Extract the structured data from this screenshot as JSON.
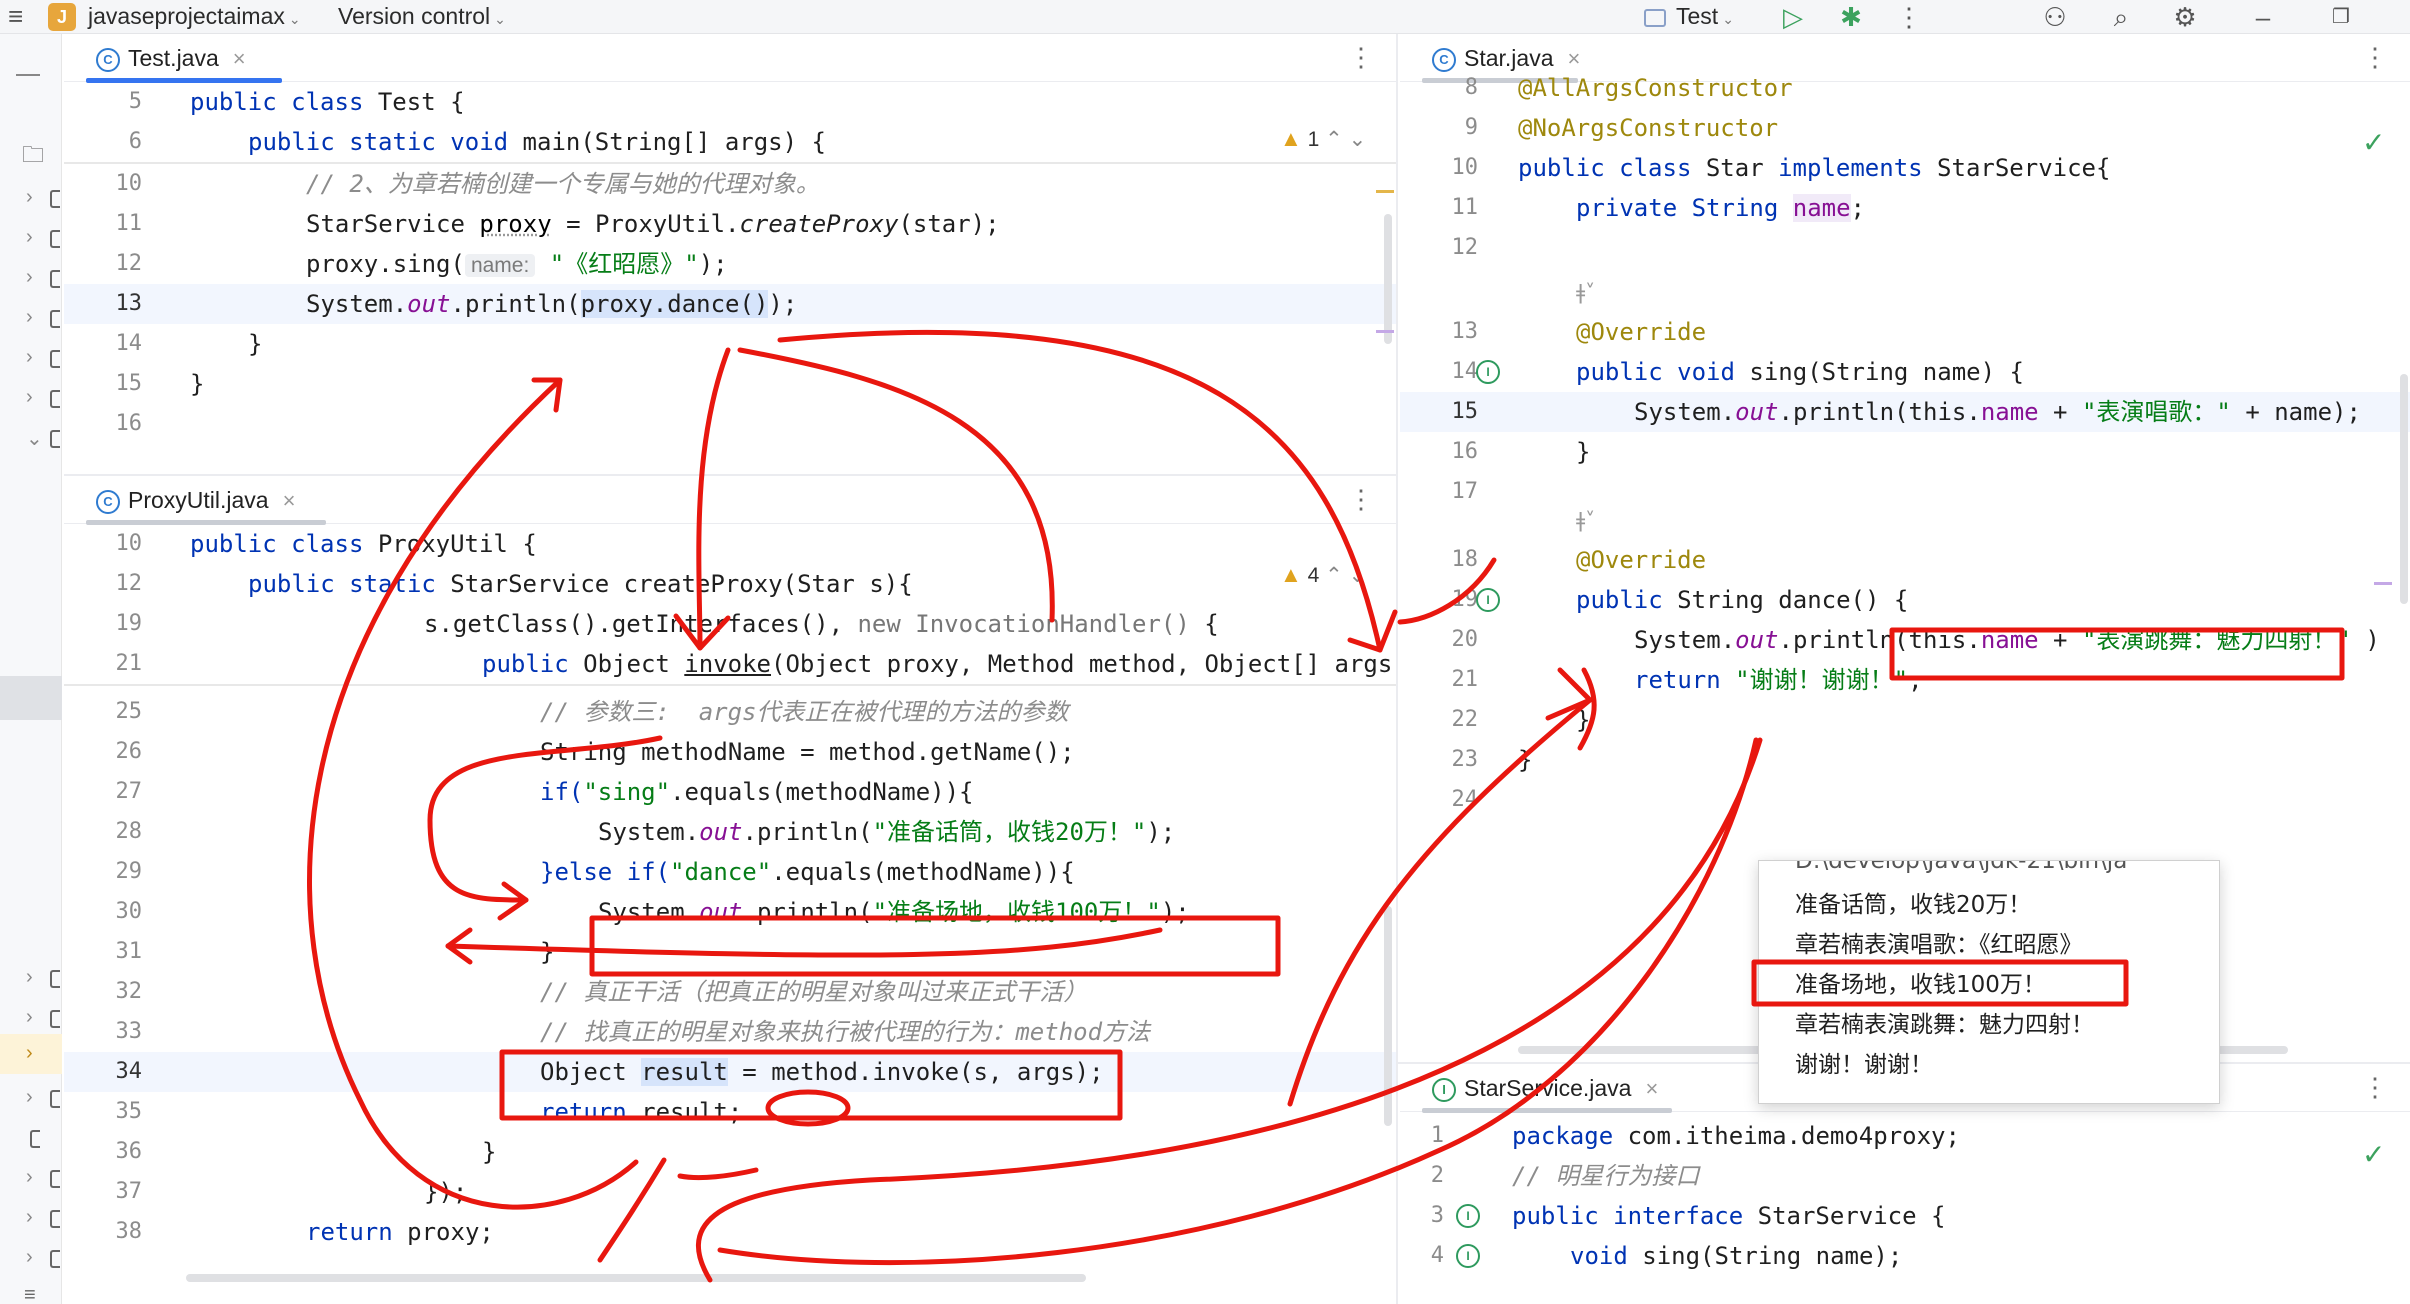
{
  "titlebar": {
    "project_letter": "J",
    "project_name": "javaseprojectaimax",
    "vcs_label": "Version control",
    "run_config": "Test"
  },
  "editors": {
    "test": {
      "tab": "Test.java",
      "warnings": "1",
      "lines": [
        {
          "n": "5",
          "t": "public class Test {"
        },
        {
          "n": "6",
          "t": "public static void main(String[] args) {"
        },
        {
          "n": "10",
          "t": "// 2、为章若楠创建一个专属与她的代理对象。"
        },
        {
          "n": "11",
          "t_pre": "StarService ",
          "var": "proxy",
          "t_mid": " = ProxyUtil.",
          "call": "createProxy",
          "t_post": "(star);"
        },
        {
          "n": "12",
          "t_pre": "proxy.sing(",
          "hint": "name:",
          "str": "\"《红昭愿》\"",
          "t_post": ");"
        },
        {
          "n": "13",
          "t_pre": "System.",
          "out": "out",
          "t_mid": ".println(",
          "hl": "proxy.dance()",
          "t_post": ");"
        },
        {
          "n": "14",
          "t": "}"
        },
        {
          "n": "15",
          "t": "}"
        },
        {
          "n": "16",
          "t": ""
        }
      ]
    },
    "proxyutil": {
      "tab": "ProxyUtil.java",
      "warnings": "4",
      "lines": [
        {
          "n": "10",
          "t": "public class ProxyUtil {"
        },
        {
          "n": "12",
          "t": "public static StarService createProxy(Star s){"
        },
        {
          "n": "19",
          "t": "s.getClass().getInterfaces(), new InvocationHandler() {"
        },
        {
          "n": "21",
          "t": "public Object invoke(Object proxy, Method method, Object[] args"
        },
        {
          "n": "25",
          "t": "// 参数三:  args代表正在被代理的方法的参数"
        },
        {
          "n": "26",
          "t": "String methodName = method.getName();"
        },
        {
          "n": "27",
          "t_pre": "if(",
          "str": "\"sing\"",
          "t_post": ".equals(methodName)){"
        },
        {
          "n": "28",
          "t_pre": "System.",
          "out": "out",
          "t_mid": ".println(",
          "str": "\"准备话筒，收钱20万！\"",
          "t_post": ");"
        },
        {
          "n": "29",
          "t_pre": "}else if(",
          "str": "\"dance\"",
          "t_post": ".equals(methodName)){"
        },
        {
          "n": "30",
          "t_pre": "System.",
          "out": "out",
          "t_mid": ".println(",
          "str": "\"准备场地，收钱100万！\"",
          "t_post": ");"
        },
        {
          "n": "31",
          "t": "}"
        },
        {
          "n": "32",
          "t": "// 真正干活（把真正的明星对象叫过来正式干活）"
        },
        {
          "n": "33",
          "t": "// 找真正的明星对象来执行被代理的行为：method方法"
        },
        {
          "n": "34",
          "t_pre": "Object ",
          "var": "result",
          "t_post": " = method.invoke(s, args);"
        },
        {
          "n": "35",
          "t": "return result;"
        },
        {
          "n": "36",
          "t": "}"
        },
        {
          "n": "37",
          "t": "});"
        },
        {
          "n": "38",
          "t": "return proxy;"
        }
      ]
    },
    "star": {
      "tab": "Star.java",
      "lines": [
        {
          "n": "8",
          "t": "@AllArgsConstructor"
        },
        {
          "n": "9",
          "t": "@NoArgsConstructor"
        },
        {
          "n": "10",
          "t": "public class Star implements StarService{"
        },
        {
          "n": "11",
          "t_pre": "private String ",
          "fld": "name",
          "t_post": ";"
        },
        {
          "n": "12",
          "t": ""
        },
        {
          "n": "",
          "t": "ǂ˅"
        },
        {
          "n": "13",
          "t": "@Override"
        },
        {
          "n": "14",
          "t": "public void sing(String name) {"
        },
        {
          "n": "15",
          "t_pre": "System.",
          "out": "out",
          "t_mid": ".println(this.",
          "fld": "name",
          "str": "\"表演唱歌：\"",
          "t_post": " + name);"
        },
        {
          "n": "16",
          "t": "}"
        },
        {
          "n": "17",
          "t": ""
        },
        {
          "n": "",
          "t": "ǂ˅"
        },
        {
          "n": "18",
          "t": "@Override"
        },
        {
          "n": "19",
          "t": "public String dance() {"
        },
        {
          "n": "20",
          "t_pre": "System.",
          "out": "out",
          "t_mid": ".println(this.",
          "fld": "name",
          "str": "\"表演跳舞：魅力四射！\"",
          "t_post": " )"
        },
        {
          "n": "21",
          "t_pre": "return ",
          "str": "\"谢谢！谢谢！\"",
          "t_post": ";"
        },
        {
          "n": "22",
          "t": "}"
        },
        {
          "n": "23",
          "t": "}"
        },
        {
          "n": "24",
          "t": ""
        }
      ]
    },
    "starservice": {
      "tab": "StarService.java",
      "lines": [
        {
          "n": "1",
          "t": "package com.itheima.demo4proxy;"
        },
        {
          "n": "2",
          "t": "// 明星行为接口"
        },
        {
          "n": "3",
          "t": "public interface StarService {"
        },
        {
          "n": "4",
          "t": "void sing(String name);"
        }
      ]
    }
  },
  "console": {
    "cut_line": "D:\\develop\\Java\\jdk-21\\bin\\ja",
    "lines": [
      "准备话筒，收钱20万！",
      "章若楠表演唱歌：《红昭愿》",
      "准备场地，收钱100万！",
      "章若楠表演跳舞：魅力四射！",
      "谢谢！谢谢！"
    ]
  },
  "colors": {
    "keyword": "#0033b3",
    "string": "#067d17",
    "annotation": "#9e880d",
    "field": "#871094",
    "comment": "#8c8c8c",
    "annotation_pen": "#e8170f",
    "accent": "#3574f0"
  }
}
